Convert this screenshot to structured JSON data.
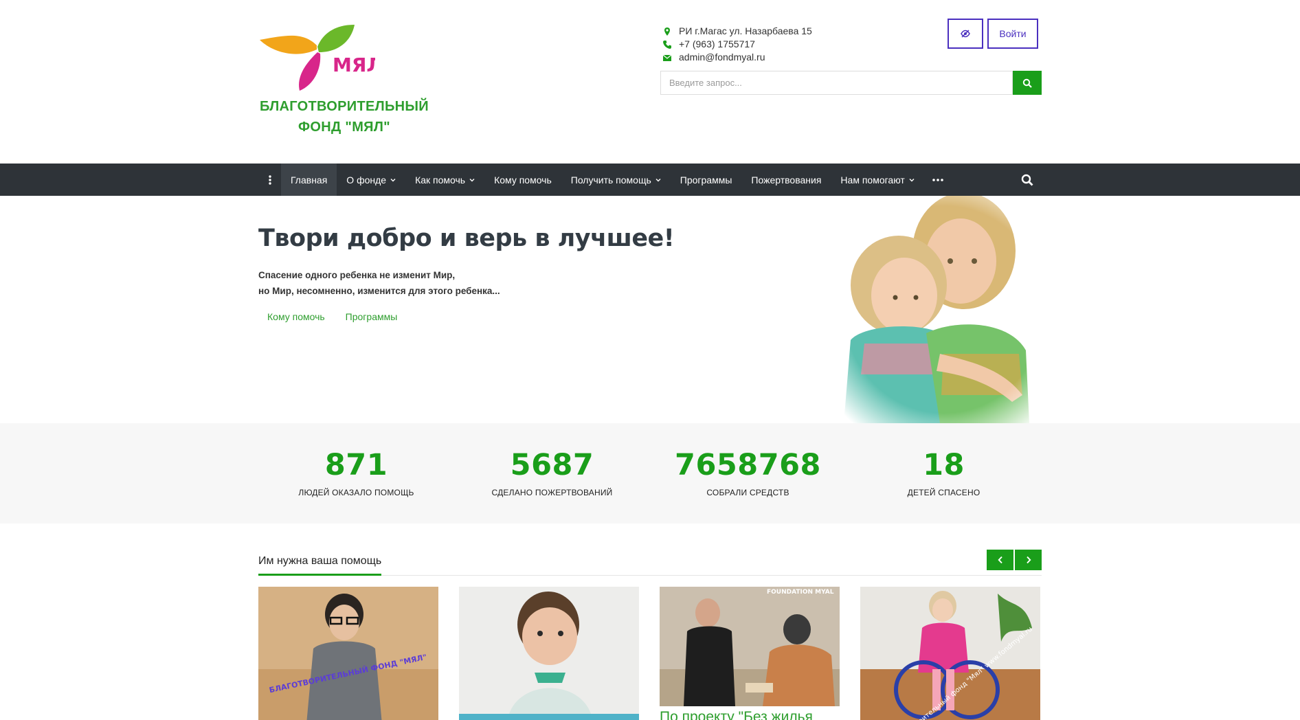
{
  "header": {
    "org_name_line1": "БЛАГОТВОРИТЕЛЬНЫЙ",
    "org_name_line2": "ФОНД  \"МЯЛ\"",
    "logo_text": "МЯЛ",
    "address": "РИ г.Магас ул. Назарбаева 15",
    "phone": "+7 (963) 1755717",
    "email": "admin@fondmyal.ru",
    "login_label": "Войти",
    "search_placeholder": "Введите запрос..."
  },
  "nav": {
    "items": [
      {
        "label": "Главная",
        "dropdown": false,
        "active": true
      },
      {
        "label": "О фонде",
        "dropdown": true
      },
      {
        "label": "Как помочь",
        "dropdown": true
      },
      {
        "label": "Кому помочь",
        "dropdown": false
      },
      {
        "label": "Получить помощь",
        "dropdown": true
      },
      {
        "label": "Программы",
        "dropdown": false
      },
      {
        "label": "Пожертвования",
        "dropdown": false
      },
      {
        "label": "Нам помогают",
        "dropdown": true
      }
    ]
  },
  "hero": {
    "title": "Твори добро и верь в лучшее!",
    "subtitle_line1": "Спасение одного ребенка не изменит Мир,",
    "subtitle_line2": "но Мир, несомненно, изменится для этого ребенка...",
    "link1": "Кому помочь",
    "link2": "Программы"
  },
  "stats": [
    {
      "value": "871",
      "label": "ЛЮДЕЙ ОКАЗАЛО ПОМОЩЬ"
    },
    {
      "value": "5687",
      "label": "СДЕЛАНО ПОЖЕРТВОВАНИЙ"
    },
    {
      "value": "7658768",
      "label": "СОБРАЛИ СРЕДСТВ"
    },
    {
      "value": "18",
      "label": "ДЕТЕЙ СПАСЕНО"
    }
  ],
  "help_section": {
    "title": "Им нужна ваша помощь",
    "card1_watermark": "БЛАГОТВОРИТЕЛЬНЫЙ   ФОНД   \"МЯЛ\"",
    "card3_watermark": "FOUNDATION  MYAL",
    "card3_title": "По проекту \"Без жилья",
    "card4_watermark": "Благотворительный фонд \"Мял\" www.fondmyal.ru"
  },
  "colors": {
    "accent_green": "#1a9e1a",
    "nav_bg": "#2e3338",
    "button_purple": "#4a2fbf"
  }
}
